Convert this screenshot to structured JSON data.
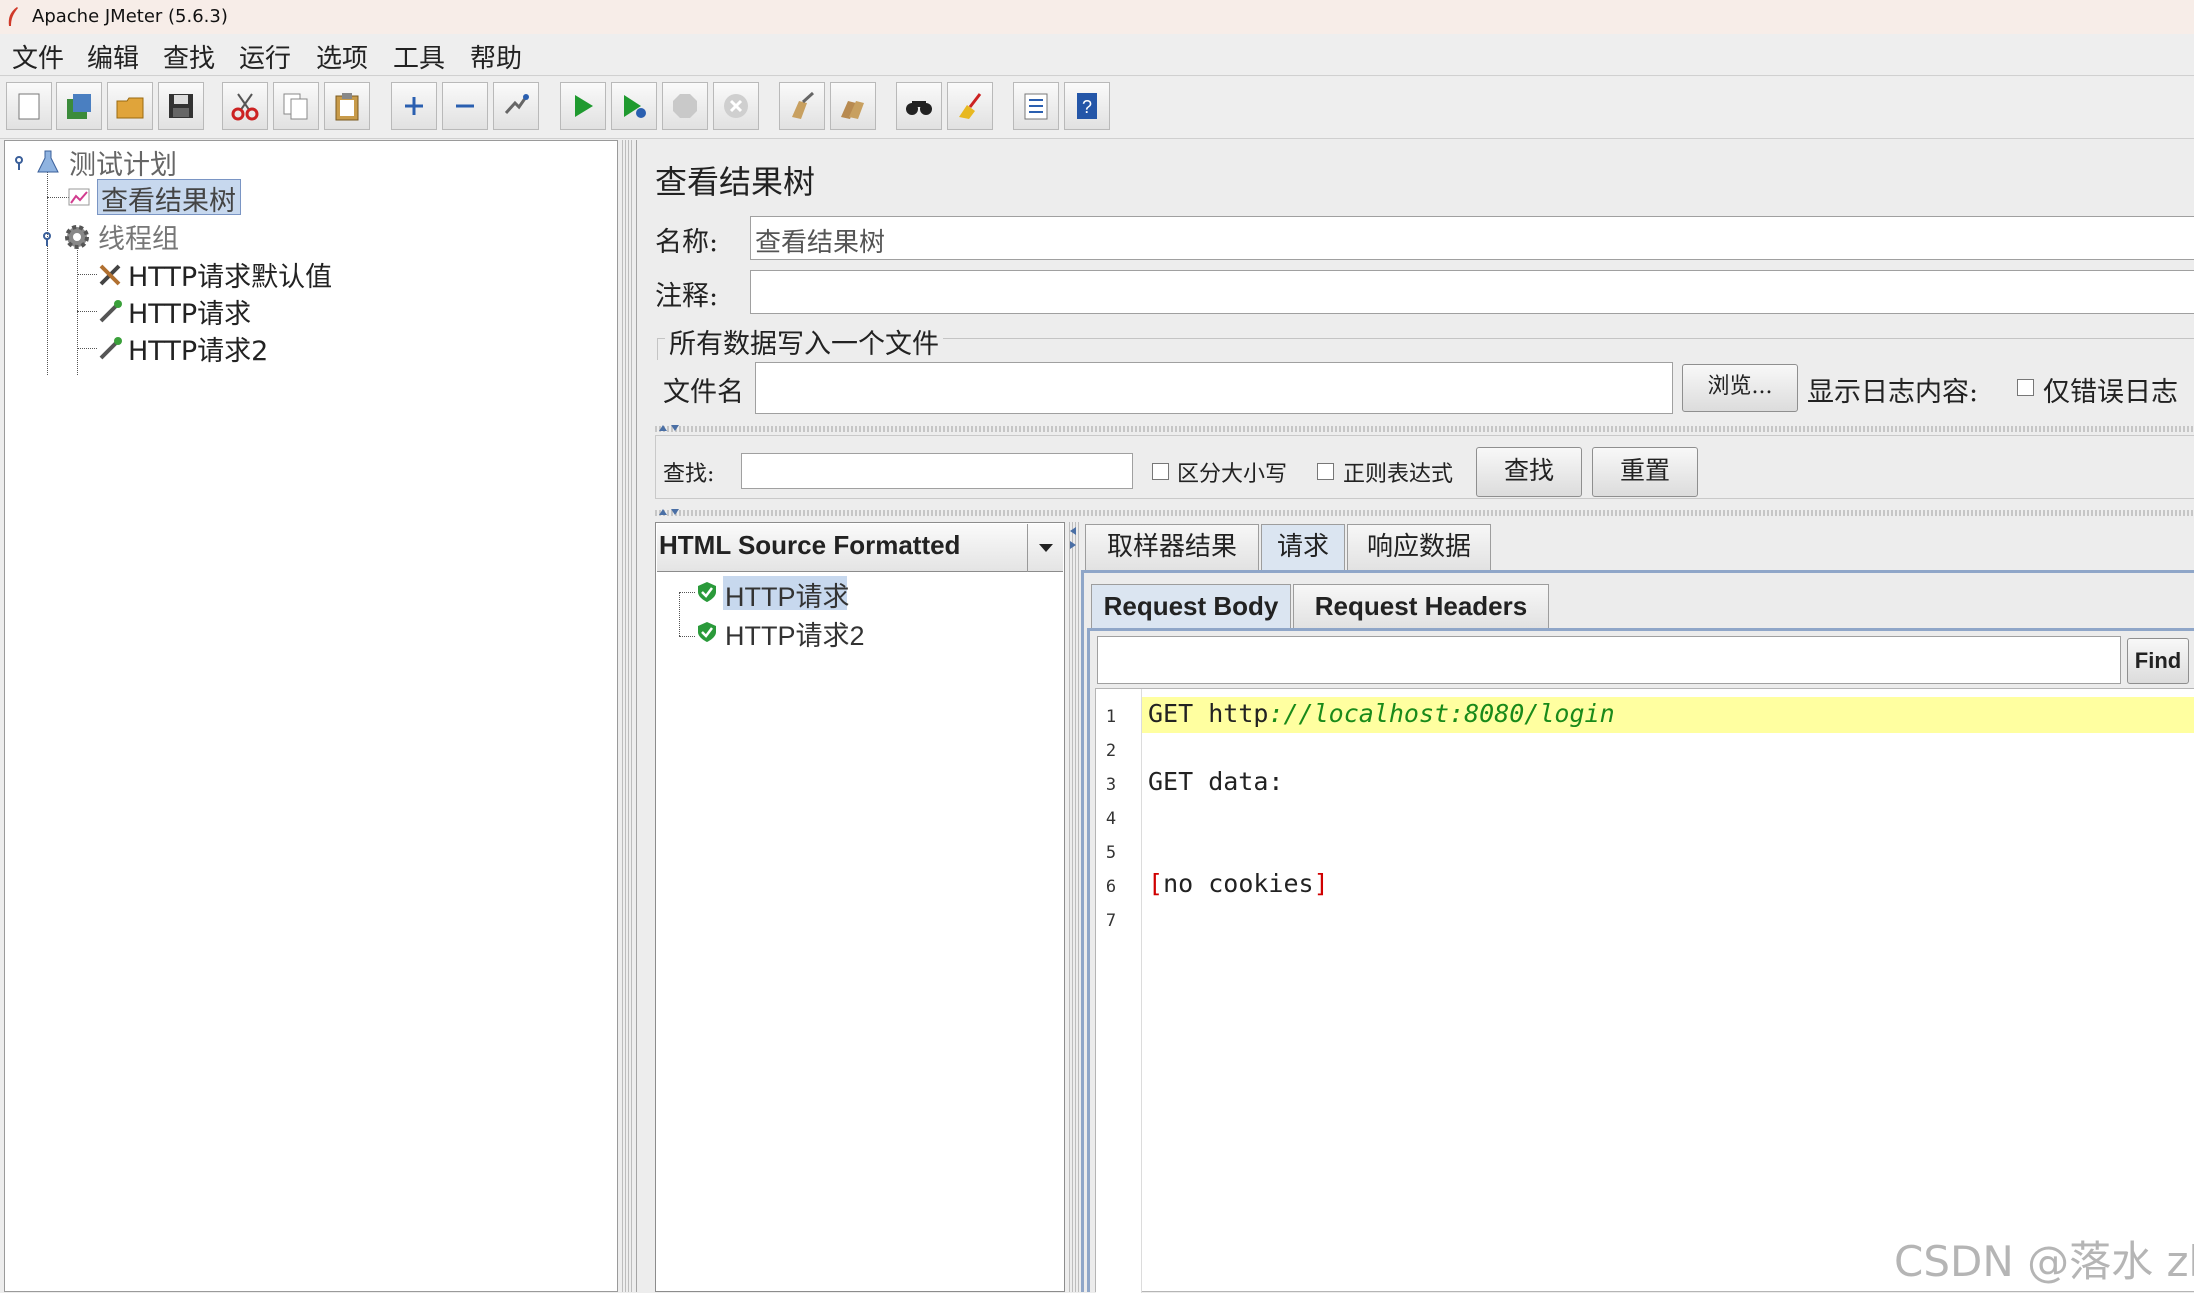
{
  "window": {
    "title": "Apache JMeter (5.6.3)"
  },
  "menu": [
    "文件",
    "编辑",
    "查找",
    "运行",
    "选项",
    "工具",
    "帮助"
  ],
  "toolbar": {
    "buttons": [
      "new-icon",
      "templates-icon",
      "open-icon",
      "save-icon",
      "cut-icon",
      "copy-icon",
      "paste-icon",
      "expand-icon",
      "collapse-icon",
      "toggle-icon",
      "start-icon",
      "start-no-pause-icon",
      "stop-icon",
      "shutdown-icon",
      "clear-icon",
      "clear-all-icon",
      "search-icon",
      "reset-search-icon",
      "function-helper-icon",
      "help-icon"
    ]
  },
  "tree": {
    "root": "测试计划",
    "results_tree": "查看结果树",
    "thread_group": "线程组",
    "children": [
      "HTTP请求默认值",
      "HTTP请求",
      "HTTP请求2"
    ]
  },
  "panel": {
    "title": "查看结果树",
    "name_label": "名称:",
    "name_value": "查看结果树",
    "comment_label": "注释:",
    "comment_value": "",
    "file_section_title": "所有数据写入一个文件",
    "filename_label": "文件名",
    "filename_value": "",
    "browse_button": "浏览...",
    "log_display_label": "显示日志内容:",
    "errors_only_label": "仅错误日志"
  },
  "search": {
    "label": "查找:",
    "value": "",
    "case_sensitive_label": "区分大小写",
    "regex_label": "正则表达式",
    "find_button": "查找",
    "reset_button": "重置"
  },
  "results": {
    "renderer": "HTML Source Formatted",
    "samples": [
      "HTTP请求",
      "HTTP请求2"
    ]
  },
  "tabs": [
    "取样器结果",
    "请求",
    "响应数据"
  ],
  "subtabs": [
    "Request Body",
    "Request Headers"
  ],
  "find_bar": {
    "value": "",
    "button": "Find"
  },
  "code_lines": [
    {
      "num": "1",
      "method": "GET ",
      "url_scheme": "http",
      "url_rest": "://localhost:8080/login"
    },
    {
      "num": "2",
      "text": ""
    },
    {
      "num": "3",
      "text": "GET data:"
    },
    {
      "num": "4",
      "text": ""
    },
    {
      "num": "5",
      "text": ""
    },
    {
      "num": "6",
      "bracket_open": "[",
      "text": "no cookies",
      "bracket_close": "]"
    },
    {
      "num": "7",
      "text": ""
    }
  ],
  "watermark": "CSDN @落水 zh",
  "colors": {
    "selection": "#c7d8ee",
    "highlight_line": "#ffffa0",
    "url_green": "#1a8a1a",
    "bracket_red": "#d00000"
  }
}
